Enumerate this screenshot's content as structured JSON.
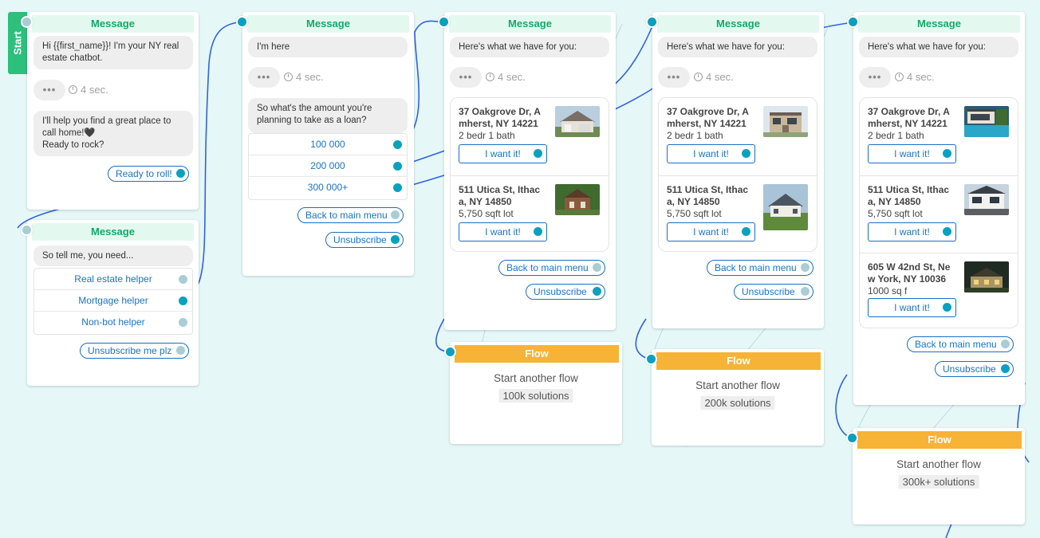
{
  "start_label": "Start",
  "msg_header": "Message",
  "flow_header": "Flow",
  "delay": "4 sec.",
  "delay_dots": "•••",
  "node1": {
    "bubble1": "Hi {{first_name}}! I'm your NY real estate chatbot.",
    "bubble2": "I'll help you find a great place to call home!🖤\nReady to rock?",
    "button": "Ready to roll!"
  },
  "node2": {
    "bubble": "So tell me, you need...",
    "quick_replies": [
      "Real estate helper",
      "Mortgage helper",
      "Non-bot helper"
    ],
    "button": "Unsubscribe me plz"
  },
  "node3": {
    "bubble1": "I'm here",
    "bubble2": "So what's the amount you're planning to take as a loan?",
    "quick_replies": [
      "100 000",
      "200 000",
      "300 000+"
    ],
    "buttons": [
      "Back to main menu",
      "Unsubscribe"
    ]
  },
  "listing_intro": "Here's what we have for you:",
  "want_label": "I want it!",
  "listings": {
    "a": {
      "title": "37 Oakgrove Dr, Amherst, NY 14221",
      "sub": "2 bedr 1 bath"
    },
    "b": {
      "title": "511 Utica St, Ithaca, NY 14850",
      "sub": "5,750 sqft lot"
    },
    "c": {
      "title": "605 W 42nd St, New York, NY 10036",
      "sub": "1000 sq f"
    }
  },
  "nav_buttons": {
    "back": "Back to main menu",
    "unsub": "Unsubscribe"
  },
  "flow_title": "Start another flow",
  "flows": [
    "100k solutions",
    "200k solutions",
    "300k+ solutions"
  ],
  "colors": {
    "accent": "#0aa1bf",
    "header_green": "#14a96b",
    "flow_orange": "#f7b335",
    "link_blue": "#1a73c9",
    "line_blue": "#2f5fe0"
  }
}
